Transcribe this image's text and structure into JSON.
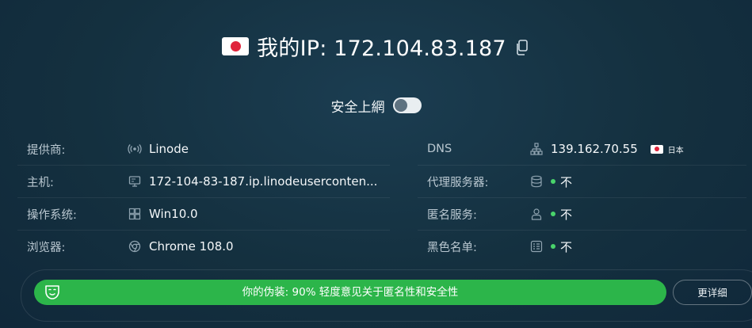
{
  "header": {
    "flag_icon": "japan-flag-icon",
    "prefix": "我的IP: ",
    "ip": "172.104.83.187",
    "copy_icon": "copy-icon"
  },
  "secure_toggle": {
    "label": "安全上網",
    "state": "off"
  },
  "left_rows": [
    {
      "label": "提供商:",
      "icon": "antenna-icon",
      "value": "Linode"
    },
    {
      "label": "主机:",
      "icon": "monitor-icon",
      "value": "172-104-83-187.ip.linodeuserconten..."
    },
    {
      "label": "操作系统:",
      "icon": "windows-icon",
      "value": "Win10.0"
    },
    {
      "label": "浏览器:",
      "icon": "chrome-icon",
      "value": "Chrome 108.0"
    }
  ],
  "right_rows": [
    {
      "label": "DNS",
      "icon": "network-icon",
      "value": "139.162.70.55",
      "country": "日本",
      "country_flag": "japan-flag-icon"
    },
    {
      "label": "代理服务器:",
      "icon": "database-icon",
      "value": "不",
      "status_color": "#49d46b"
    },
    {
      "label": "匿名服务:",
      "icon": "user-icon",
      "value": "不",
      "status_color": "#49d46b"
    },
    {
      "label": "黑色名单:",
      "icon": "list-icon",
      "value": "不",
      "status_color": "#49d46b"
    }
  ],
  "disguise": {
    "icon": "mask-icon",
    "text": "你的伪装: 90% 轻度意见关于匿名性和安全性",
    "percent": 90,
    "bar_color": "#2cb54a",
    "details_label": "更详细"
  }
}
